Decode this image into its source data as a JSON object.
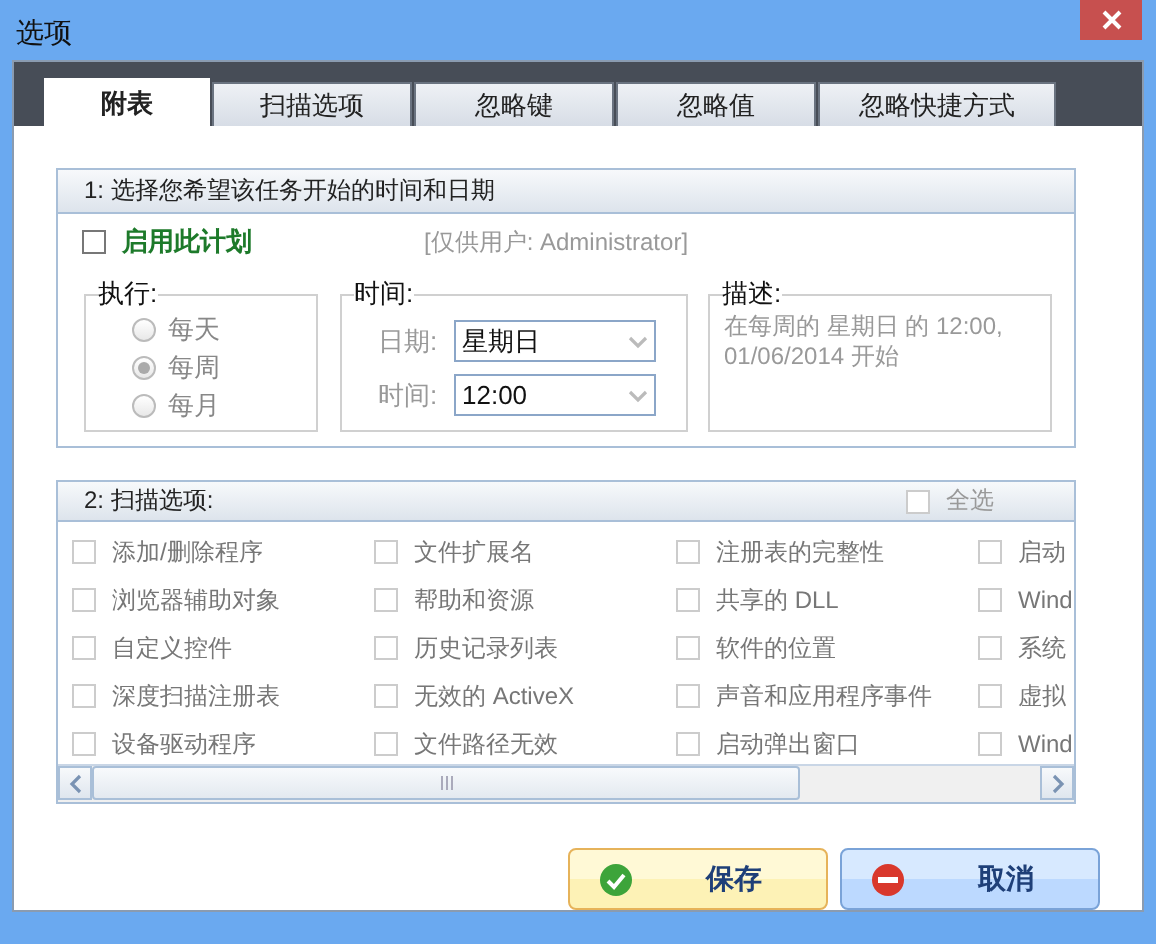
{
  "window": {
    "title": "选项"
  },
  "tabs": [
    {
      "label": "附表",
      "selected": true
    },
    {
      "label": "扫描选项",
      "selected": false
    },
    {
      "label": "忽略键",
      "selected": false
    },
    {
      "label": "忽略值",
      "selected": false
    },
    {
      "label": "忽略快捷方式",
      "selected": false
    }
  ],
  "schedule": {
    "header": "1: 选择您希望该任务开始的时间和日期",
    "enable": {
      "label": "启用此计划",
      "checked": false
    },
    "user_note": "[仅供用户: Administrator]",
    "run": {
      "legend": "执行:",
      "options": [
        {
          "label": "每天",
          "selected": false
        },
        {
          "label": "每周",
          "selected": true
        },
        {
          "label": "每月",
          "selected": false
        }
      ]
    },
    "time": {
      "legend": "时间:",
      "date_label": "日期:",
      "date_value": "星期日",
      "time_label": "时间:",
      "time_value": "12:00"
    },
    "description": {
      "legend": "描述:",
      "text": "在每周的 星期日 的 12:00, 01/06/2014 开始"
    }
  },
  "scan_options": {
    "header": "2: 扫描选项:",
    "select_all": {
      "label": "全选",
      "checked": false
    },
    "items": [
      {
        "label": "添加/删除程序",
        "checked": false
      },
      {
        "label": "文件扩展名",
        "checked": false
      },
      {
        "label": "注册表的完整性",
        "checked": false
      },
      {
        "label": "启动",
        "checked": false
      },
      {
        "label": "浏览器辅助对象",
        "checked": false
      },
      {
        "label": "帮助和资源",
        "checked": false
      },
      {
        "label": "共享的 DLL",
        "checked": false
      },
      {
        "label": "Wind",
        "checked": false
      },
      {
        "label": "自定义控件",
        "checked": false
      },
      {
        "label": "历史记录列表",
        "checked": false
      },
      {
        "label": "软件的位置",
        "checked": false
      },
      {
        "label": "系统",
        "checked": false
      },
      {
        "label": "深度扫描注册表",
        "checked": false
      },
      {
        "label": "无效的 ActiveX",
        "checked": false
      },
      {
        "label": "声音和应用程序事件",
        "checked": false
      },
      {
        "label": "虚拟",
        "checked": false
      },
      {
        "label": "设备驱动程序",
        "checked": false
      },
      {
        "label": "文件路径无效",
        "checked": false
      },
      {
        "label": "启动弹出窗口",
        "checked": false
      },
      {
        "label": "Wind",
        "checked": false
      }
    ]
  },
  "buttons": [
    {
      "label": "保存",
      "kind": "save"
    },
    {
      "label": "取消",
      "kind": "cancel"
    }
  ]
}
